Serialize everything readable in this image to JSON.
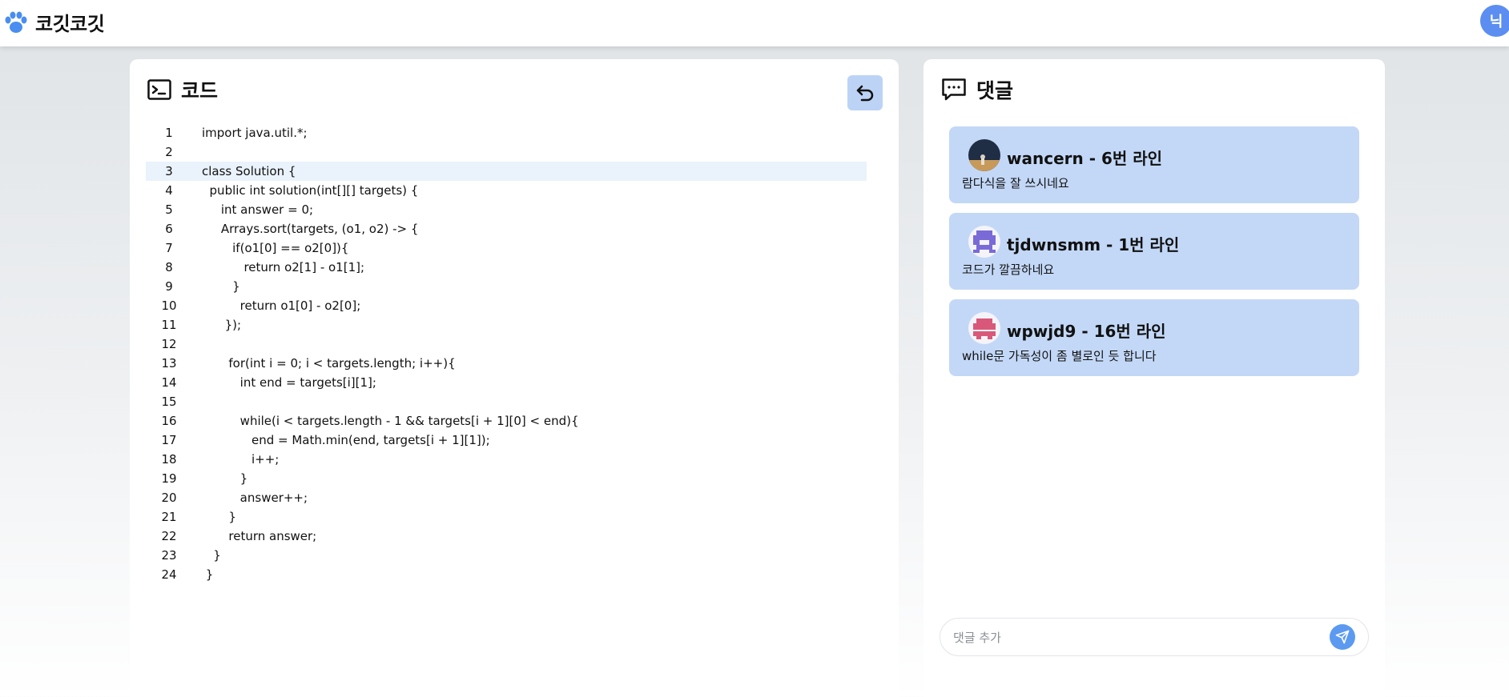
{
  "header": {
    "app_name": "코깃코깃",
    "user_initial": "닉"
  },
  "code_panel": {
    "title": "코드",
    "highlighted_line": 3,
    "lines": [
      {
        "num": "1",
        "text": "import java.util.*;"
      },
      {
        "num": "2",
        "text": ""
      },
      {
        "num": "3",
        "text": "class Solution {"
      },
      {
        "num": "4",
        "text": "  public int solution(int[][] targets) {"
      },
      {
        "num": "5",
        "text": "     int answer = 0;"
      },
      {
        "num": "6",
        "text": "     Arrays.sort(targets, (o1, o2) -> {"
      },
      {
        "num": "7",
        "text": "        if(o1[0] == o2[0]){"
      },
      {
        "num": "8",
        "text": "           return o2[1] - o1[1];"
      },
      {
        "num": "9",
        "text": "        }"
      },
      {
        "num": "10",
        "text": "          return o1[0] - o2[0];"
      },
      {
        "num": "11",
        "text": "      });"
      },
      {
        "num": "12",
        "text": ""
      },
      {
        "num": "13",
        "text": "       for(int i = 0; i < targets.length; i++){"
      },
      {
        "num": "14",
        "text": "          int end = targets[i][1];"
      },
      {
        "num": "15",
        "text": ""
      },
      {
        "num": "16",
        "text": "          while(i < targets.length - 1 && targets[i + 1][0] < end){"
      },
      {
        "num": "17",
        "text": "             end = Math.min(end, targets[i + 1][1]);"
      },
      {
        "num": "18",
        "text": "             i++;"
      },
      {
        "num": "19",
        "text": "          }"
      },
      {
        "num": "20",
        "text": "          answer++;"
      },
      {
        "num": "21",
        "text": "       }"
      },
      {
        "num": "22",
        "text": "       return answer;"
      },
      {
        "num": "23",
        "text": "   }"
      },
      {
        "num": "24",
        "text": " }"
      }
    ]
  },
  "comment_panel": {
    "title": "댓글",
    "comments": [
      {
        "header": "wancern - 6번 라인",
        "body": "람다식을 잘 쓰시네요",
        "avatar": "photo-avatar"
      },
      {
        "header": "tjdwnsmm - 1번 라인",
        "body": "코드가 깔끔하네요",
        "avatar": "purple-pixel-avatar"
      },
      {
        "header": "wpwjd9 - 16번 라인",
        "body": "while문 가독성이 좀 별로인 듯 합니다",
        "avatar": "pink-pixel-avatar"
      }
    ],
    "input_placeholder": "댓글 추가"
  },
  "colors": {
    "accent": "#5b9af0",
    "card_bg": "#c3d8f7",
    "highlight_line": "#eaf2fc"
  }
}
